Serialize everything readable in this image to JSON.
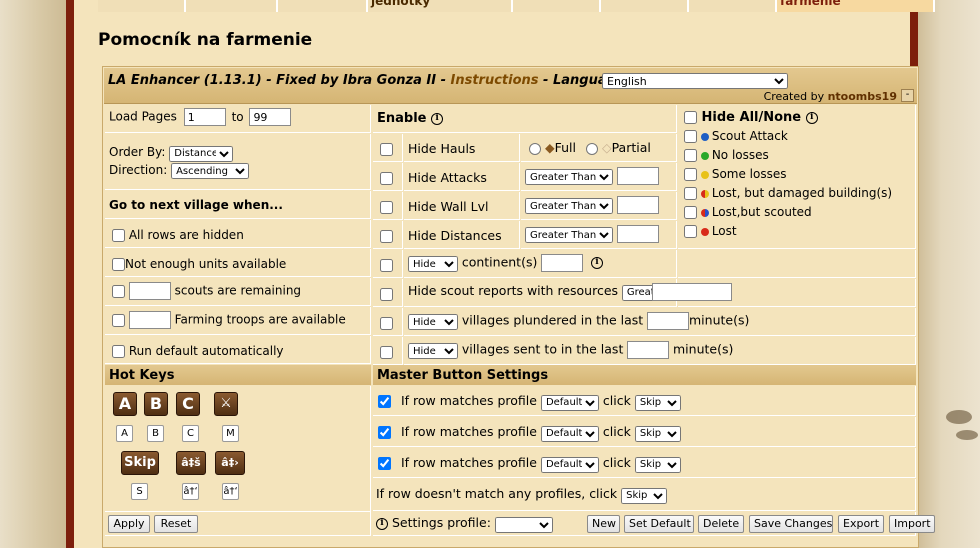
{
  "nav": {
    "tabs": [
      {
        "label": "jednotky"
      },
      {
        "label": "farmenie"
      }
    ]
  },
  "page_title": "Pomocník na farmenie",
  "enhancer": {
    "title_prefix": "LA Enhancer (1.13.1) - Fixed by Ibra Gonza II - ",
    "instructions": "Instructions",
    "language_label": " - Language:",
    "language_value": "English",
    "credit_prefix": "Created by ",
    "credit_author": "ntoombs19",
    "minimize": "-"
  },
  "left": {
    "load_pages_label": "Load Pages",
    "load_from": "1",
    "to_label": "to",
    "load_to": "99",
    "order_by_label": "Order By:",
    "order_by_value": "Distance",
    "direction_label": "Direction:",
    "direction_value": "Ascending",
    "go_next_label": "Go to next village when...",
    "all_rows_hidden": "All rows are hidden",
    "not_enough_units": "Not enough units available",
    "scouts_remaining": "scouts are remaining",
    "farming_troops": "Farming troops are available",
    "run_default": "Run default automatically"
  },
  "enable": {
    "header": "Enable",
    "hide_hauls": "Hide Hauls",
    "full": "Full",
    "partial": "Partial",
    "hide_attacks": "Hide Attacks",
    "hide_wall": "Hide Wall Lvl",
    "hide_distances": "Hide Distances",
    "comparison": "Greater Than",
    "hide_option": "Hide",
    "continents": "continent(s)",
    "hide_scout_reports": "Hide scout reports with resources",
    "villages_plundered": "villages plundered in the last",
    "villages_sent": "villages sent to in the last",
    "minutes": "minute(s)"
  },
  "report_filters": {
    "header": "Hide All/None",
    "items": [
      {
        "label": "Scout Attack",
        "color": "#1f5fc4"
      },
      {
        "label": "No losses",
        "color": "#2aa82a"
      },
      {
        "label": "Some losses",
        "color": "#e8c21a"
      },
      {
        "label": "Lost, but damaged building(s)",
        "color": "#e0a020"
      },
      {
        "label": "Lost,but scouted",
        "color": "#2a4fc8"
      },
      {
        "label": "Lost",
        "color": "#d82a1a"
      }
    ]
  },
  "hotkeys": {
    "header": "Hot Keys",
    "buttons": [
      "A",
      "B",
      "C",
      "M"
    ],
    "keys": [
      "A",
      "B",
      "C",
      "M"
    ],
    "skip": "Skip",
    "prev_icon": "â‡š",
    "next_icon": "â‡›",
    "skip_key": "S",
    "prev_key": "â†‘",
    "next_key": "â†‘"
  },
  "master": {
    "header": "Master Button Settings",
    "row_label": "If row matches profile",
    "profile": "Default",
    "click_label": "click",
    "action": "Skip",
    "no_match_label": "If row doesn't match any profiles, click",
    "no_match_action": "Skip"
  },
  "footer": {
    "apply": "Apply",
    "reset": "Reset",
    "settings_profile": "Settings profile:",
    "new": "New",
    "set_default": "Set Default",
    "delete": "Delete",
    "save_changes": "Save Changes",
    "export": "Export",
    "import": "Import"
  }
}
